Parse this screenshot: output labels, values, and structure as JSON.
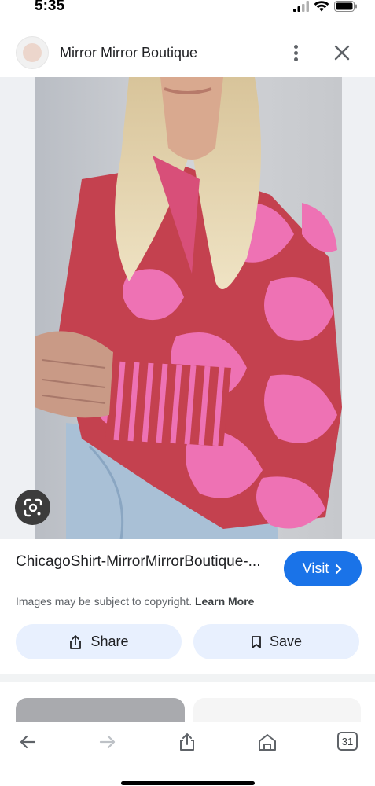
{
  "status": {
    "time": "5:35"
  },
  "header": {
    "site_name": "Mirror Mirror Boutique"
  },
  "result": {
    "caption": "ChicagoShirt-MirrorMirrorBoutique-...",
    "visit_label": "Visit",
    "copyright_text": "Images may be subject to copyright.",
    "learn_more_label": "Learn More",
    "share_label": "Share",
    "save_label": "Save"
  },
  "toolbar": {
    "tab_count": "31"
  },
  "colors": {
    "accent": "#1a73e8",
    "pill_bg": "#e8f0fe",
    "shirt_base": "#c4414f",
    "shirt_pattern": "#ee72b4"
  }
}
